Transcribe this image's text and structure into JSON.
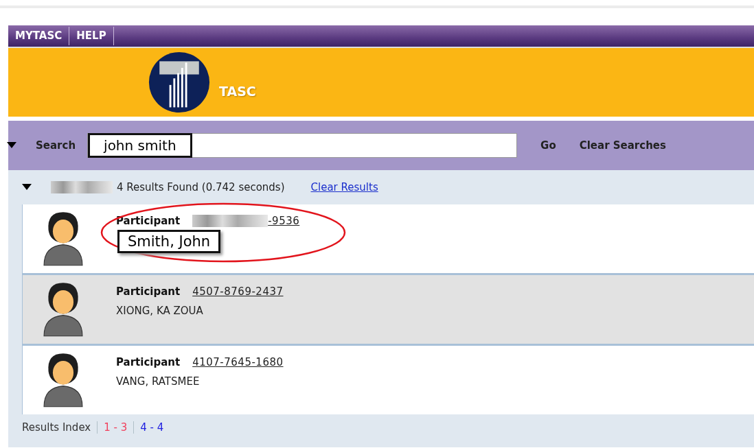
{
  "nav": [
    {
      "label": "MYTASC"
    },
    {
      "label": "HELP"
    }
  ],
  "brand": {
    "name": "TASC"
  },
  "search": {
    "label": "Search",
    "value": "john smith",
    "go": "Go",
    "clear": "Clear Searches"
  },
  "results": {
    "redacted_label": true,
    "summary": "4 Results Found (0.742 seconds)",
    "clear": "Clear Results",
    "rows": [
      {
        "type": "Participant",
        "account_redacted": true,
        "account": "-9536",
        "name": "Smith, John",
        "annotated": true,
        "highlighted": false
      },
      {
        "type": "Participant",
        "account_redacted": false,
        "account": "4507-8769-2437",
        "name": "XIONG, KA ZOUA",
        "annotated": false,
        "highlighted": true
      },
      {
        "type": "Participant",
        "account_redacted": false,
        "account": "4107-7645-1680",
        "name": "VANG, RATSMEE",
        "annotated": false,
        "highlighted": false
      }
    ],
    "index_label": "Results Index",
    "pages": [
      {
        "label": "1 - 3",
        "selected": true
      },
      {
        "label": "4 - 4",
        "selected": false
      }
    ]
  }
}
